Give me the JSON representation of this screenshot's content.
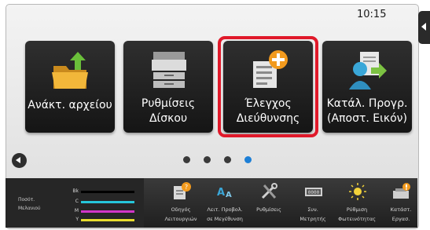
{
  "status": {
    "time": "10:15"
  },
  "tiles": [
    {
      "lines": [
        "Ανάκτ. αρχείου"
      ],
      "icon": "folder-upload-icon"
    },
    {
      "lines": [
        "Ρυθμίσεις",
        "Δίσκου"
      ],
      "icon": "printer-tray-icon"
    },
    {
      "lines": [
        "Έλεγχος",
        "Διεύθυνσης"
      ],
      "icon": "address-check-icon",
      "highlighted": true
    },
    {
      "lines": [
        "Κατάλ. Προγρ.",
        "(Αποστ. Εικόν)"
      ],
      "icon": "send-program-icon"
    }
  ],
  "pagination": {
    "pages": 4,
    "active_index": 3
  },
  "toner": {
    "label_line1": "Ποσότ.",
    "label_line2": "Μελανιού",
    "levels": [
      {
        "name": "Bk",
        "color": "#000000"
      },
      {
        "name": "C",
        "color": "#26c6da"
      },
      {
        "name": "M",
        "color": "#d236c8"
      },
      {
        "name": "Y",
        "color": "#e8dc2e"
      }
    ]
  },
  "bottom_icons": [
    {
      "line1": "Οδηγός",
      "line2": "Λειτουργιών",
      "icon": "operation-guide-icon"
    },
    {
      "line1": "Λειτ. Προβολ.",
      "line2": "σε Μεγέθυνση",
      "icon": "enlarged-display-icon"
    },
    {
      "line1": "Ρυθμίσεις",
      "line2": "",
      "icon": "settings-tools-icon"
    },
    {
      "line1": "Συν.",
      "line2": "Μετρητής",
      "icon": "total-count-icon"
    },
    {
      "line1": "Ρύθμιση",
      "line2": "Φωτεινότητας",
      "icon": "brightness-icon"
    },
    {
      "line1": "Κατάστ.",
      "line2": "Εργασ.",
      "icon": "job-status-icon"
    }
  ],
  "colors": {
    "accent_highlight": "#e0192a",
    "active_dot": "#1d7fd6",
    "tile_bg": "#1e1e1e"
  }
}
